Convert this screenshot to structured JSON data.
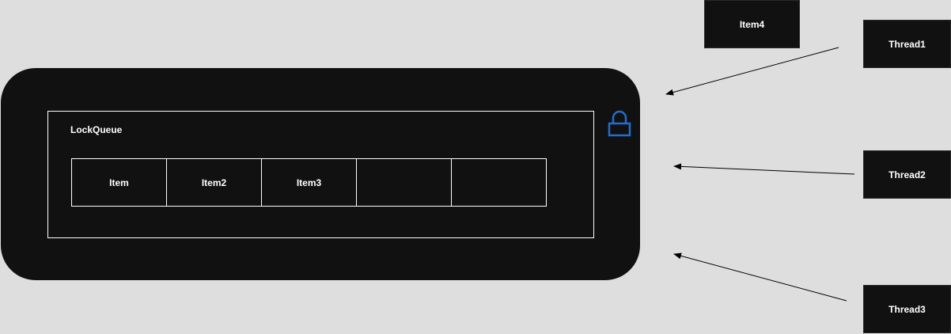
{
  "diagram": {
    "queue_label": "LockQueue",
    "slots": [
      "Item",
      "Item2",
      "Item3",
      "",
      ""
    ],
    "pending_item": "Item4",
    "threads": [
      "Thread1",
      "Thread2",
      "Thread3"
    ],
    "lock_icon": "lock-icon",
    "colors": {
      "background": "#dedede",
      "container": "#111111",
      "lock": "#1f6fd1",
      "arrow": "#000000"
    }
  }
}
